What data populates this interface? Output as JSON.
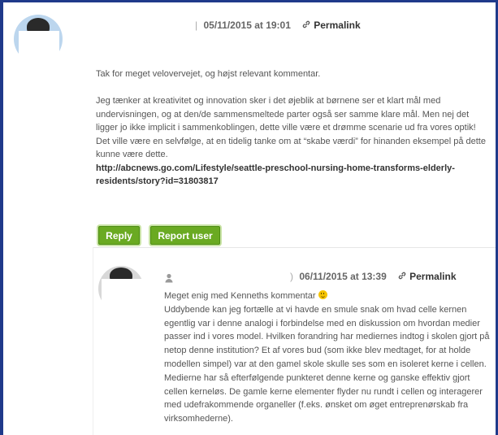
{
  "comment1": {
    "date": "05/11/2015 at 19:01",
    "permalink": "Permalink",
    "paragraph1": "Tak for meget velovervejet, og højst relevant kommentar.",
    "paragraph2": "Jeg tænker at kreativitet og innovation sker i det øjeblik at børnene ser et klart mål med undervisningen, og at den/de sammensmeltede parter også ser samme klare mål. Men nej det ligger jo ikke implicit i sammenkoblingen, dette ville være et drømme scenarie ud fra vores optik!",
    "paragraph3": "Det ville være en selvfølge, at en tidelig tanke om at “skabe værdi” for hinanden eksempel på dette kunne være dette.",
    "url": "http://abcnews.go.com/Lifestyle/seattle-preschool-nursing-home-transforms-elderly-residents/story?id=31803817",
    "reply_label": "Reply",
    "report_label": "Report user"
  },
  "comment2": {
    "date": "06/11/2015 at 13:39",
    "permalink": "Permalink",
    "first_line": "Meget enig med Kenneths kommentar",
    "body": "Uddybende kan jeg fortælle at vi havde en smule snak om hvad celle kernen egentlig var i denne analogi i forbindelse med en diskussion om hvordan medier passer ind i vores model. Hvilken forandring har mediernes indtog i skolen gjort på netop denne institution? Et af vores bud (som ikke blev medtaget, for at holde modellen simpel) var at den gamel skole skulle ses som en isoleret kerne i cellen. Medierne har så efterfølgende punkteret denne kerne og ganske effektiv gjort cellen kerneløs. De gamle kerne elementer flyder nu rundt i cellen og interagerer med udefrakommende organeller (f.eks. ønsket om øget entreprenørskab fra virksomhederne)."
  },
  "colors": {
    "frame": "#1f3a8a",
    "button": "#6aaa22"
  }
}
